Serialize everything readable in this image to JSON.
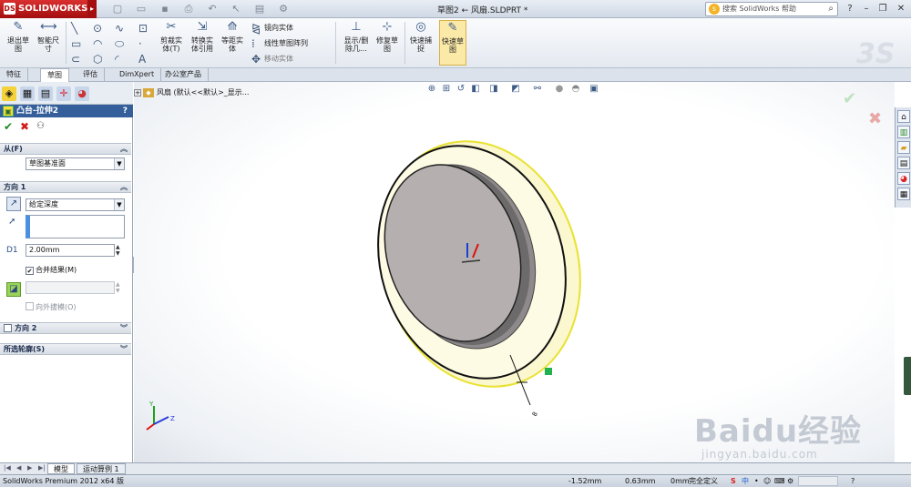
{
  "app": {
    "brand": "SOLIDWORKS",
    "document_title": "草图2 ← 风扇.SLDPRT *"
  },
  "search": {
    "placeholder": "搜索 SolidWorks 帮助"
  },
  "ribbon": {
    "exit_sketch": "退出草\n图",
    "smart_dimension": "智能尺\n寸",
    "trim": "剪裁实\n体(T)",
    "convert": "转换实\n体引用",
    "offset": "等距实\n体",
    "mirror": "镜向实体",
    "linear_pattern": "线性草图阵列",
    "move": "移动实体",
    "show_delete": "显示/删\n除几…",
    "repair": "修复草\n图",
    "quick_snaps": "快速捕\n捉",
    "rapid_sketch": "快速草\n图"
  },
  "tabs": [
    "特征",
    "草图",
    "评估",
    "DimXpert",
    "办公室产品"
  ],
  "active_tab": "草图",
  "property_manager": {
    "title": "凸台-拉伸2",
    "help": "?",
    "from_group": "从(F)",
    "from_value": "草图基准面",
    "dir1_group": "方向 1",
    "end_condition": "给定深度",
    "depth": "2.00mm",
    "merge_label": "合并结果(M)",
    "merge_checked": true,
    "draft_label": "向外拔模(O)",
    "dir2_group": "方向 2",
    "contours_group": "所选轮廓(S)"
  },
  "tree": {
    "root": "风扇  (默认<<默认>_显示..."
  },
  "bottom_tabs": [
    "模型",
    "运动算例 1"
  ],
  "status": {
    "app_version": "SolidWorks Premium 2012 x64 版",
    "x": "-1.52mm",
    "y": "0.63mm",
    "z": "0mm",
    "state": "完全定义"
  },
  "watermark": {
    "main": "Baidu经验",
    "sub": "jingyan.baidu.com"
  },
  "colors": {
    "brand_red": "#c41b1b",
    "pm_header": "#345f9b",
    "face_gray": "#b4afae",
    "highlight_yellow": "#fbf7c8"
  }
}
